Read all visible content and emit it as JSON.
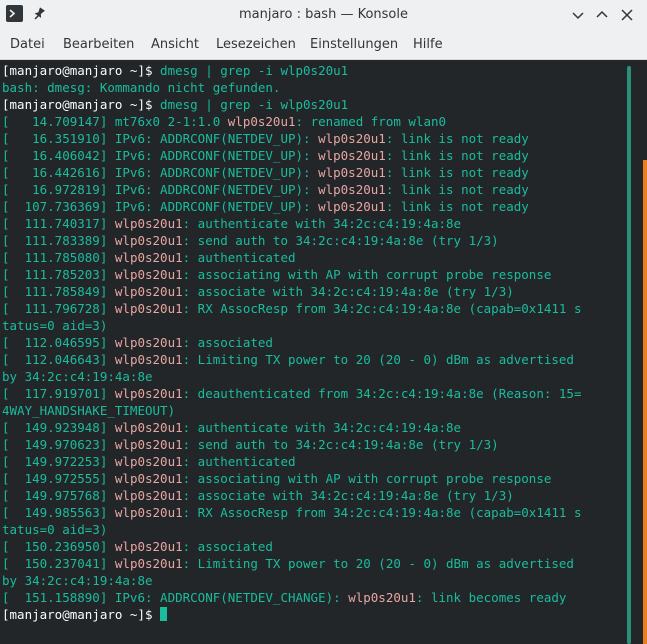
{
  "window": {
    "title": "manjaro : bash — Konsole"
  },
  "titlebar_icons": {
    "app": "konsole-terminal-icon",
    "pin": "pin-icon",
    "minimize": "chevron-down-icon",
    "maximize": "chevron-up-icon",
    "close": "close-icon"
  },
  "menubar": {
    "items": [
      "Datei",
      "Bearbeiten",
      "Ansicht",
      "Lesezeichen",
      "Einstellungen",
      "Hilfe"
    ]
  },
  "colors": {
    "terminal_bg": "#232629",
    "text_teal": "#1abc9c",
    "device_pink": "#e7a5a1",
    "prompt_white": "#fcfcfc",
    "chrome_bg": "#eff0f1"
  },
  "terminal": {
    "lines": [
      [
        {
          "t": "[manjaro@manjaro ~]$ ",
          "c": "prompt"
        },
        {
          "t": "dmesg | grep -i wlp0s20u1",
          "c": "cmd"
        }
      ],
      [
        {
          "t": "bash: dmesg: Kommando nicht gefunden.",
          "c": "err"
        }
      ],
      [
        {
          "t": "[manjaro@manjaro ~]$ ",
          "c": "prompt"
        },
        {
          "t": "dmesg | grep -i wlp0s20u1",
          "c": "cmd"
        }
      ],
      [
        {
          "t": "[   14.709147] mt76x0 2-1:1.0 ",
          "c": "ts"
        },
        {
          "t": "wlp0s20u1",
          "c": "dev"
        },
        {
          "t": ": renamed from wlan0",
          "c": "msg"
        }
      ],
      [
        {
          "t": "[   16.351910] IPv6: ADDRCONF(NETDEV_UP): ",
          "c": "ts"
        },
        {
          "t": "wlp0s20u1",
          "c": "dev"
        },
        {
          "t": ": link is not ready",
          "c": "msg"
        }
      ],
      [
        {
          "t": "[   16.406042] IPv6: ADDRCONF(NETDEV_UP): ",
          "c": "ts"
        },
        {
          "t": "wlp0s20u1",
          "c": "dev"
        },
        {
          "t": ": link is not ready",
          "c": "msg"
        }
      ],
      [
        {
          "t": "[   16.442616] IPv6: ADDRCONF(NETDEV_UP): ",
          "c": "ts"
        },
        {
          "t": "wlp0s20u1",
          "c": "dev"
        },
        {
          "t": ": link is not ready",
          "c": "msg"
        }
      ],
      [
        {
          "t": "[   16.972819] IPv6: ADDRCONF(NETDEV_UP): ",
          "c": "ts"
        },
        {
          "t": "wlp0s20u1",
          "c": "dev"
        },
        {
          "t": ": link is not ready",
          "c": "msg"
        }
      ],
      [
        {
          "t": "[  107.736369] IPv6: ADDRCONF(NETDEV_UP): ",
          "c": "ts"
        },
        {
          "t": "wlp0s20u1",
          "c": "dev"
        },
        {
          "t": ": link is not ready",
          "c": "msg"
        }
      ],
      [
        {
          "t": "[  111.740317] ",
          "c": "ts"
        },
        {
          "t": "wlp0s20u1",
          "c": "dev"
        },
        {
          "t": ": authenticate with 34:2c:c4:19:4a:8e",
          "c": "msg"
        }
      ],
      [
        {
          "t": "[  111.783389] ",
          "c": "ts"
        },
        {
          "t": "wlp0s20u1",
          "c": "dev"
        },
        {
          "t": ": send auth to 34:2c:c4:19:4a:8e (try 1/3)",
          "c": "msg"
        }
      ],
      [
        {
          "t": "[  111.785080] ",
          "c": "ts"
        },
        {
          "t": "wlp0s20u1",
          "c": "dev"
        },
        {
          "t": ": authenticated",
          "c": "msg"
        }
      ],
      [
        {
          "t": "[  111.785203] ",
          "c": "ts"
        },
        {
          "t": "wlp0s20u1",
          "c": "dev"
        },
        {
          "t": ": associating with AP with corrupt probe response",
          "c": "msg"
        }
      ],
      [
        {
          "t": "[  111.785849] ",
          "c": "ts"
        },
        {
          "t": "wlp0s20u1",
          "c": "dev"
        },
        {
          "t": ": associate with 34:2c:c4:19:4a:8e (try 1/3)",
          "c": "msg"
        }
      ],
      [
        {
          "t": "[  111.796728] ",
          "c": "ts"
        },
        {
          "t": "wlp0s20u1",
          "c": "dev"
        },
        {
          "t": ": RX AssocResp from 34:2c:c4:19:4a:8e (capab=0x1411 s",
          "c": "msg"
        }
      ],
      [
        {
          "t": "tatus=0 aid=3)",
          "c": "msg"
        }
      ],
      [
        {
          "t": "[  112.046595] ",
          "c": "ts"
        },
        {
          "t": "wlp0s20u1",
          "c": "dev"
        },
        {
          "t": ": associated",
          "c": "msg"
        }
      ],
      [
        {
          "t": "[  112.046643] ",
          "c": "ts"
        },
        {
          "t": "wlp0s20u1",
          "c": "dev"
        },
        {
          "t": ": Limiting TX power to 20 (20 - 0) dBm as advertised",
          "c": "msg"
        }
      ],
      [
        {
          "t": "by 34:2c:c4:19:4a:8e",
          "c": "msg"
        }
      ],
      [
        {
          "t": "[  117.919701] ",
          "c": "ts"
        },
        {
          "t": "wlp0s20u1",
          "c": "dev"
        },
        {
          "t": ": deauthenticated from 34:2c:c4:19:4a:8e (Reason: 15=",
          "c": "msg"
        }
      ],
      [
        {
          "t": "4WAY_HANDSHAKE_TIMEOUT)",
          "c": "msg"
        }
      ],
      [
        {
          "t": "[  149.923948] ",
          "c": "ts"
        },
        {
          "t": "wlp0s20u1",
          "c": "dev"
        },
        {
          "t": ": authenticate with 34:2c:c4:19:4a:8e",
          "c": "msg"
        }
      ],
      [
        {
          "t": "[  149.970623] ",
          "c": "ts"
        },
        {
          "t": "wlp0s20u1",
          "c": "dev"
        },
        {
          "t": ": send auth to 34:2c:c4:19:4a:8e (try 1/3)",
          "c": "msg"
        }
      ],
      [
        {
          "t": "[  149.972253] ",
          "c": "ts"
        },
        {
          "t": "wlp0s20u1",
          "c": "dev"
        },
        {
          "t": ": authenticated",
          "c": "msg"
        }
      ],
      [
        {
          "t": "[  149.972555] ",
          "c": "ts"
        },
        {
          "t": "wlp0s20u1",
          "c": "dev"
        },
        {
          "t": ": associating with AP with corrupt probe response",
          "c": "msg"
        }
      ],
      [
        {
          "t": "[  149.975768] ",
          "c": "ts"
        },
        {
          "t": "wlp0s20u1",
          "c": "dev"
        },
        {
          "t": ": associate with 34:2c:c4:19:4a:8e (try 1/3)",
          "c": "msg"
        }
      ],
      [
        {
          "t": "[  149.985563] ",
          "c": "ts"
        },
        {
          "t": "wlp0s20u1",
          "c": "dev"
        },
        {
          "t": ": RX AssocResp from 34:2c:c4:19:4a:8e (capab=0x1411 s",
          "c": "msg"
        }
      ],
      [
        {
          "t": "tatus=0 aid=3)",
          "c": "msg"
        }
      ],
      [
        {
          "t": "[  150.236950] ",
          "c": "ts"
        },
        {
          "t": "wlp0s20u1",
          "c": "dev"
        },
        {
          "t": ": associated",
          "c": "msg"
        }
      ],
      [
        {
          "t": "[  150.237041] ",
          "c": "ts"
        },
        {
          "t": "wlp0s20u1",
          "c": "dev"
        },
        {
          "t": ": Limiting TX power to 20 (20 - 0) dBm as advertised",
          "c": "msg"
        }
      ],
      [
        {
          "t": "by 34:2c:c4:19:4a:8e",
          "c": "msg"
        }
      ],
      [
        {
          "t": "[  151.158890] IPv6: ADDRCONF(NETDEV_CHANGE): ",
          "c": "ts"
        },
        {
          "t": "wlp0s20u1",
          "c": "dev"
        },
        {
          "t": ": link becomes ready",
          "c": "msg"
        }
      ],
      [
        {
          "t": "[manjaro@manjaro ~]$ ",
          "c": "prompt"
        }
      ]
    ]
  }
}
